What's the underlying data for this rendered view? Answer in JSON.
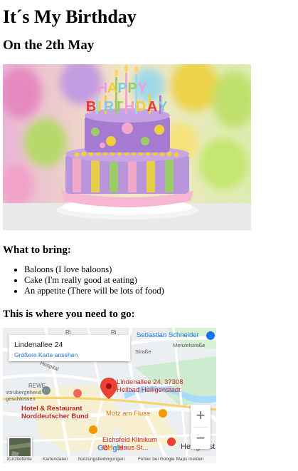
{
  "page": {
    "title": "It´s My Birthday",
    "date_heading": "On the 2th May",
    "bring_heading": "What to bring:",
    "bring_items": [
      "Baloons (I love baloons)",
      "Cake (I'm really good at eating)",
      "An appetite (There will be lots of food)"
    ],
    "directions_heading": "This is where you need to go:"
  },
  "cake_image": {
    "candle_letters": [
      "H",
      "A",
      "P",
      "P",
      "Y",
      "B",
      "I",
      "R",
      "T",
      "H",
      "D",
      "A",
      "Y"
    ]
  },
  "map": {
    "place_name": "Lindenallee 24",
    "larger_map_link": "Größere Karte ansehen",
    "marker_label": [
      "Lindenallee 24, 37308",
      "Heilbad Heiligenstadt"
    ],
    "pois": {
      "restaurant": [
        "Hotel & Restaurant",
        "Norddeutscher Bund"
      ],
      "cafe": "Motz am Fluss",
      "hospital": [
        "Eichsfeld Klinikum",
        "GH - Haus St..."
      ],
      "shop": "Sebastian Schneider",
      "rewe": "REWE",
      "rewe_note": [
        "vorübergehend",
        "geschlossen"
      ]
    },
    "streets": {
      "menzel": "Menzelstraße",
      "strasse": "Straße",
      "hospital_str": "Hospital",
      "r1": "Ri",
      "r2": "Ri",
      "heilig": "Heiligenst"
    },
    "zoom_in": "+",
    "zoom_out": "−",
    "google_logo": [
      "G",
      "o",
      "o",
      "g",
      "l",
      "e"
    ],
    "footer": {
      "shortcuts": "Kurzbefehle",
      "map_data": "Kartendaten",
      "terms": "Nutzungsbedingungen",
      "report": "Fehler bei Google Maps melden"
    },
    "colors": {
      "marker": "#ea4335",
      "restaurant_text": "#c5221f",
      "cafe": "#f29900",
      "shop": "#1a73e8",
      "park": "#cdeccf",
      "water": "#aadaff"
    }
  }
}
